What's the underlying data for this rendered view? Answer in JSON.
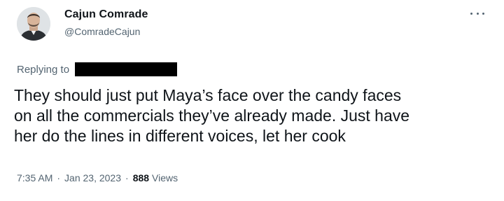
{
  "author": {
    "name": "Cajun Comrade",
    "handle": "@ComradeCajun",
    "avatar_icon": "profile-photo"
  },
  "more_icon": "more-options-icon",
  "replying": {
    "label": "Replying to",
    "redacted_color": "#000000"
  },
  "tweet": {
    "lines": [
      "They should just put Maya’s face over the candy faces",
      "on all the commercials they’ve already made. Just have",
      "her do the lines in different voices, let her cook"
    ]
  },
  "meta": {
    "time": "7:35 AM",
    "separator": "·",
    "date": "Jan 23, 2023",
    "views_count": "888",
    "views_label": "Views"
  },
  "colors": {
    "text_primary": "#0f1419",
    "text_secondary": "#536471",
    "background": "#ffffff"
  }
}
